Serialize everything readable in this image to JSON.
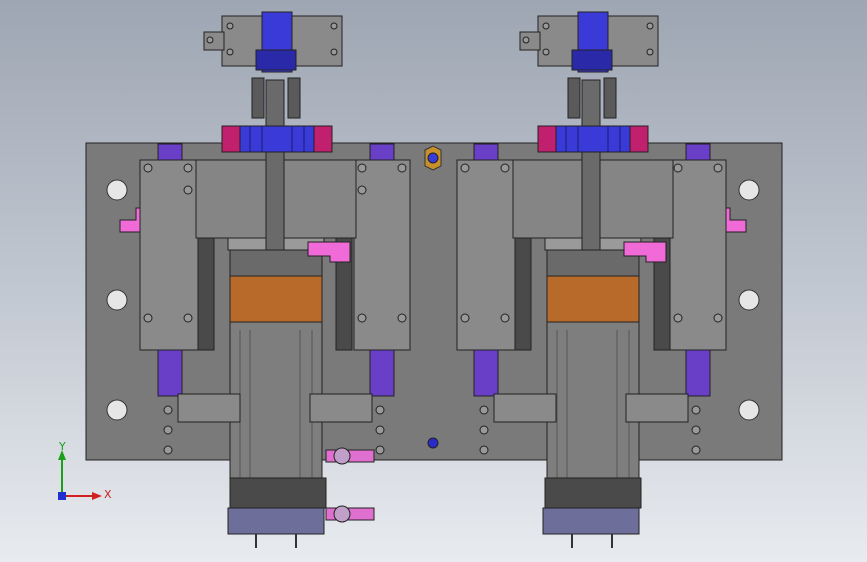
{
  "viewport": {
    "background_top": "#9ea6b3",
    "background_bottom": "#e8ebef"
  },
  "model": {
    "plate_color": "#7a7a7a",
    "block_color": "#8a8a8a",
    "purple_color": "#6a3fc8",
    "magenta_color": "#c0206e",
    "blue_gear_color": "#3a3ad8",
    "pink_color": "#f06ad8",
    "copper_color": "#b86a2a",
    "motor_color": "#7e7e7e",
    "base_plate_color": "#6e6e9a"
  },
  "triad": {
    "x_label": "X",
    "y_label": "Y",
    "x_color": "#d02020",
    "y_color": "#1aa01a",
    "z_color": "#2030d0"
  }
}
